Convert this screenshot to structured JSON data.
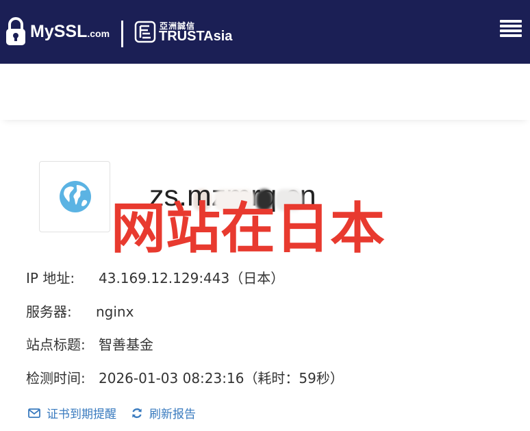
{
  "header": {
    "brand_name": "MySSL",
    "brand_suffix": ".com",
    "partner_cn": "亞洲誠信",
    "partner_en": "TRUSTAsia",
    "menu_icon": "hamburger-menu-icon",
    "colors": {
      "bar": "#1b1f55",
      "text": "#ffffff"
    }
  },
  "site": {
    "icon": "globe-icon",
    "domain": "zs.mzmrq.cn",
    "stamp": "网站在日本",
    "stamp_color": "#e83a2f"
  },
  "details": [
    {
      "label": "IP 地址:",
      "value": "43.169.12.129:443（日本）"
    },
    {
      "label": "服务器:",
      "value": "nginx"
    },
    {
      "label": "站点标题:",
      "value": "智善基金"
    },
    {
      "label": "检测时间:",
      "value": "2026-01-03 08:23:16（耗时：59秒）"
    }
  ],
  "actions": {
    "cert_reminder": {
      "label": "证书到期提醒",
      "icon": "mail-icon"
    },
    "refresh_report": {
      "label": "刷新报告",
      "icon": "refresh-icon"
    },
    "color": "#3a7bbf"
  }
}
